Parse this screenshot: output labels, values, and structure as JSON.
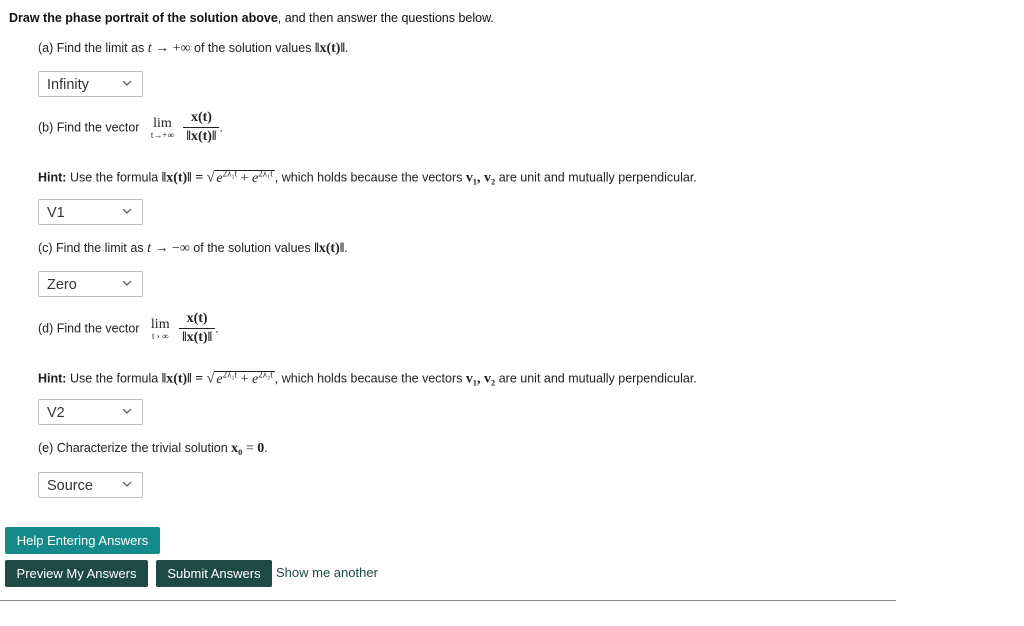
{
  "heading": {
    "bold": "Draw the phase portrait of the solution above",
    "rest": ", and then answer the questions below."
  },
  "part_a": {
    "text_before": "(a) Find the limit as ",
    "t": "t",
    "arrow": "→ +∞",
    "text_middle": " of the solution values ",
    "norm": "‖x(t)‖",
    "end": ".",
    "selected": "Infinity"
  },
  "part_b": {
    "text_before": "(b) Find the vector",
    "lim": "lim",
    "lim_sub": "t→+∞",
    "numerator": "x(t)",
    "denominator": "‖x(t)‖",
    "end": ".",
    "hint_label": "Hint:",
    "hint_text1": " Use the formula ",
    "hint_norm": "‖x(t)‖ = ",
    "hint_sqrt_a": "e",
    "hint_sqrt_a_exp": "2λ₁t",
    "hint_plus": " + ",
    "hint_sqrt_b": "e",
    "hint_sqrt_b_exp": "2λ₁t",
    "hint_text2": ", which holds because the vectors ",
    "hint_vectors": "v₁, v₂",
    "hint_text3": " are unit and mutually perpendicular.",
    "selected": "V1"
  },
  "part_c": {
    "text_before": "(c) Find the limit as ",
    "t": "t",
    "arrow": "→ −∞",
    "text_middle": " of the solution values ",
    "norm": "‖x(t)‖",
    "end": ".",
    "selected": "Zero"
  },
  "part_d": {
    "text_before": "(d) Find the vector",
    "lim": "lim",
    "lim_sub": "t › ∞",
    "numerator": "x(t)",
    "denominator": "‖x(t)‖",
    "end": ".",
    "hint_label": "Hint:",
    "hint_text1": " Use the formula ",
    "hint_norm": "‖x(t)‖ = ",
    "hint_sqrt_a": "e",
    "hint_sqrt_a_exp": "2λ₁t",
    "hint_plus": " + ",
    "hint_sqrt_b": "e",
    "hint_sqrt_b_exp": "2λ₂t",
    "hint_text2": ", which holds because the vectors ",
    "hint_vectors": "v₁, v₂",
    "hint_text3": " are unit and mutually perpendicular.",
    "selected": "V2"
  },
  "part_e": {
    "text_before": "(e) Characterize the trivial solution ",
    "x0": "x₀",
    "eq": " = ",
    "zero": "0",
    "end": ".",
    "selected": "Source"
  },
  "buttons": {
    "help": "Help Entering Answers",
    "preview": "Preview My Answers",
    "submit": "Submit Answers",
    "another": "Show me another"
  },
  "colors": {
    "help_button": "#158a8a",
    "action_button": "#1f4a44"
  },
  "icons": {
    "dropdown": "chevron-down-icon"
  }
}
